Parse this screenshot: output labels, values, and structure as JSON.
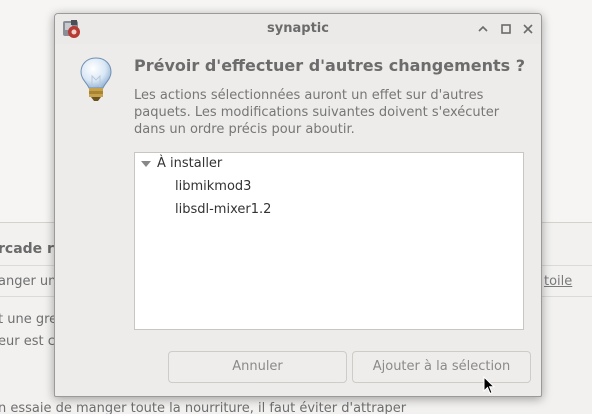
{
  "background_window": {
    "heading": "rcade r",
    "line1": "anger un",
    "line2": "t une gre",
    "line3": "eur est c",
    "line4": "n essaie de manger toute la nourriture, il faut éviter d'attraper",
    "link": "toile"
  },
  "dialog": {
    "title": "synaptic",
    "app_icon": "synaptic-package-icon",
    "window_buttons": {
      "maximize_up": "chevron-up-icon",
      "restore": "square-icon",
      "close": "close-icon"
    },
    "icon": "lightbulb-icon",
    "heading": "Prévoir d'effectuer d'autres changements ?",
    "message": "Les actions sélectionnées auront un effet sur d'autres paquets. Les modifications suivantes doivent s'exécuter dans un ordre précis pour aboutir.",
    "tree": {
      "group_label": "À installer",
      "items": [
        "libmikmod3",
        "libsdl-mixer1.2"
      ]
    },
    "buttons": {
      "cancel": "Annuler",
      "add": "Ajouter à la sélection"
    }
  }
}
